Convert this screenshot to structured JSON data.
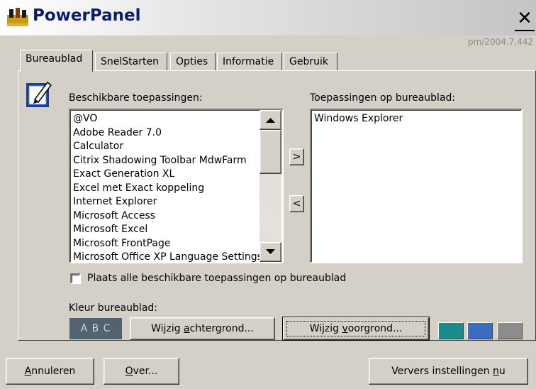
{
  "window": {
    "title": "PowerPanel",
    "version": "pm/2004.7.442"
  },
  "tabs": [
    "Bureaublad",
    "SnelStarten",
    "Opties",
    "Informatie",
    "Gebruik"
  ],
  "available_label": "Beschikbare toepassingen:",
  "desktop_label": "Toepassingen op bureaublad:",
  "available_apps": [
    "@VO",
    "Adobe Reader 7.0",
    "Calculator",
    "Citrix Shadowing Toolbar MdwFarm",
    "Exact Generation XL",
    "Excel met Exact koppeling",
    "Internet Explorer",
    "Microsoft Access",
    "Microsoft Excel",
    "Microsoft FrontPage",
    "Microsoft Office XP Language Settings"
  ],
  "desktop_apps": [
    "Windows Explorer"
  ],
  "move_right_label": ">",
  "move_left_label": "<",
  "checkbox_label": "Plaats alle beschikbare toepassingen op bureaublad",
  "color_label": "Kleur bureaublad:",
  "color_preview": {
    "text": "A B C",
    "background": "#536270",
    "text_color": "#cfd6dc"
  },
  "background_button": {
    "before": "Wijzig ",
    "accel": "a",
    "after": "chtergrond..."
  },
  "foreground_button": {
    "before": "Wijzig ",
    "accel": "v",
    "after": "oorgrond..."
  },
  "swatch_colors": [
    "#188c8c",
    "#3c6cc0",
    "#8c8c8c"
  ],
  "cancel_button": {
    "accel": "A",
    "after": "nnuleren"
  },
  "about_button": {
    "accel": "O",
    "after": "ver..."
  },
  "refresh_button": {
    "before": "Ververs instellingen ",
    "accel": "n",
    "after": "u"
  }
}
